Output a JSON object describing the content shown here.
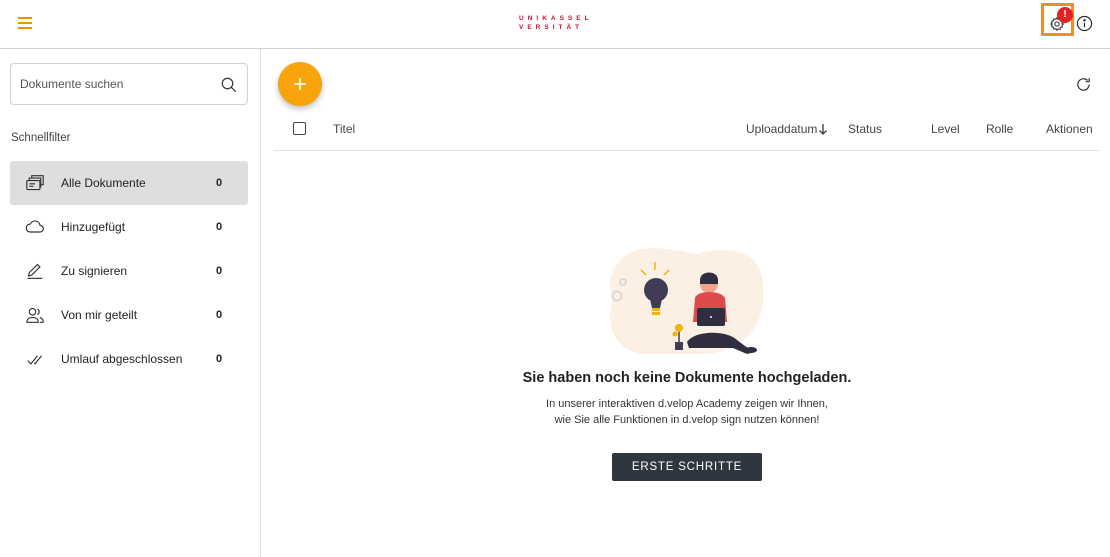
{
  "topbar": {
    "logo_line1": "UNIKASSEL",
    "logo_line2": "VERSITÄT",
    "settings_badge": "!",
    "menu_icon": "hamburger-icon",
    "settings_icon": "gear-icon",
    "info_icon": "info-icon"
  },
  "sidebar": {
    "search": {
      "placeholder": "Dokumente suchen",
      "value": ""
    },
    "section_title": "Schnellfilter",
    "items": [
      {
        "label": "Alle Dokumente",
        "count": "0",
        "icon": "documents-stack-icon",
        "active": true
      },
      {
        "label": "Hinzugefügt",
        "count": "0",
        "icon": "cloud-icon",
        "active": false
      },
      {
        "label": "Zu signieren",
        "count": "0",
        "icon": "pen-icon",
        "active": false
      },
      {
        "label": "Von mir geteilt",
        "count": "0",
        "icon": "users-icon",
        "active": false
      },
      {
        "label": "Umlauf abgeschlossen",
        "count": "0",
        "icon": "double-check-icon",
        "active": false
      }
    ]
  },
  "main": {
    "add_button_icon": "plus-icon",
    "refresh_icon": "refresh-icon",
    "table": {
      "columns": {
        "title": "Titel",
        "upload": "Uploaddatum",
        "status": "Status",
        "level": "Level",
        "rolle": "Rolle",
        "aktionen": "Aktionen"
      },
      "sort_indicator": "arrow-down-icon"
    },
    "empty": {
      "title": "Sie haben noch keine Dokumente hochgeladen.",
      "line1": "In unserer interaktiven d.velop Academy zeigen wir Ihnen,",
      "line2": "wie Sie alle Funktionen in d.velop sign nutzen können!",
      "cta": "ERSTE SCHRITTE"
    }
  },
  "colors": {
    "accent": "#f7a30b",
    "highlight_border": "#f28c28",
    "badge": "#e02424",
    "brand": "#c8102e",
    "cta_bg": "#2f3640",
    "active_item_bg": "#dedede"
  }
}
